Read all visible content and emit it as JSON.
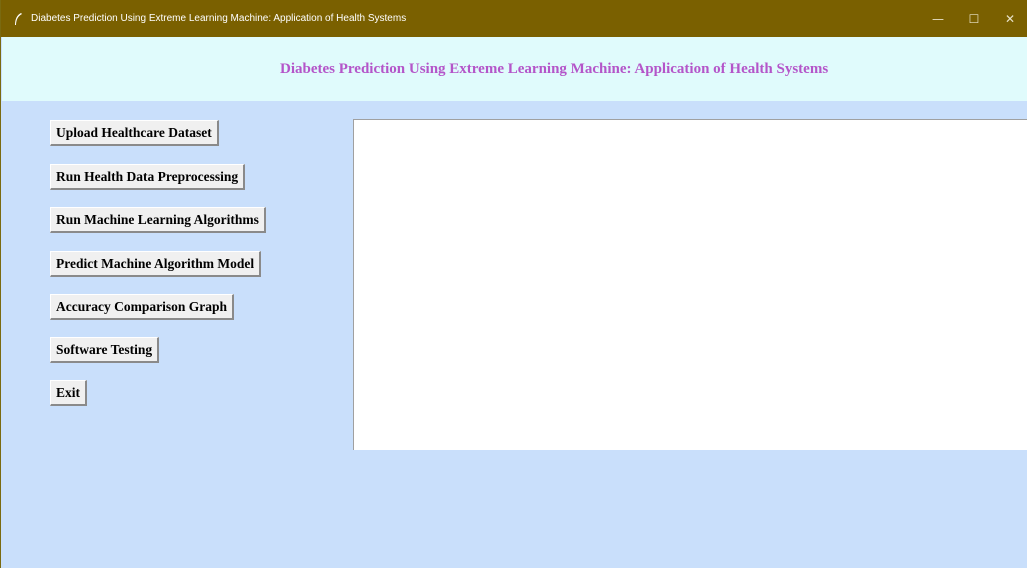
{
  "window": {
    "title": "Diabetes Prediction Using Extreme Learning Machine: Application of Health Systems",
    "icon": "feather-icon",
    "controls": {
      "minimize": "—",
      "maximize": "☐",
      "close": "✕"
    }
  },
  "header": {
    "heading": "Diabetes Prediction Using Extreme Learning Machine: Application of Health Systems",
    "heading_color": "#b455c9",
    "band_color": "#e0fbfc"
  },
  "buttons": [
    "Upload Healthcare Dataset",
    "Run Health Data Preprocessing",
    "Run Machine Learning Algorithms",
    "Predict Machine Algorithm Model",
    "Accuracy Comparison Graph",
    "Software Testing",
    "Exit"
  ],
  "output": {
    "text": ""
  },
  "colors": {
    "titlebar": "#7a6000",
    "background": "#c9dffb"
  }
}
